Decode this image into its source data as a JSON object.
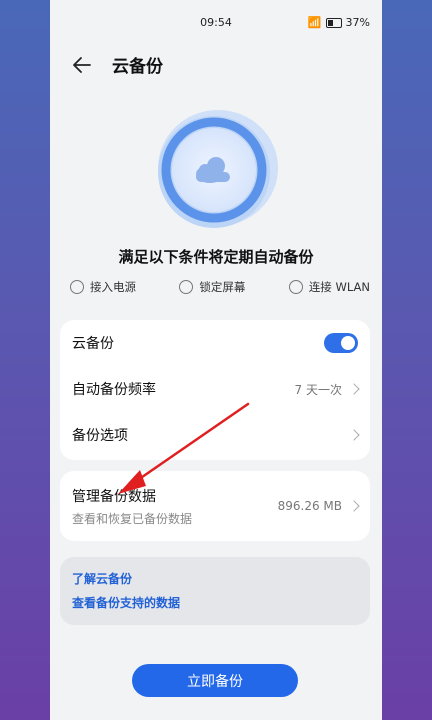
{
  "status_bar": {
    "time": "09:54",
    "battery": "37%"
  },
  "header": {
    "title": "云备份"
  },
  "hero": {
    "heading": "满足以下条件将定期自动备份"
  },
  "conditions": [
    {
      "label": "接入电源",
      "icon": "power-plug-icon"
    },
    {
      "label": "锁定屏幕",
      "icon": "lock-icon"
    },
    {
      "label": "连接 WLAN",
      "icon": "wifi-icon"
    }
  ],
  "settings": {
    "cloud_backup_label": "云备份",
    "cloud_backup_enabled": true,
    "frequency_label": "自动备份频率",
    "frequency_value": "7 天一次",
    "options_label": "备份选项"
  },
  "manage": {
    "label": "管理备份数据",
    "subtitle": "查看和恢复已备份数据",
    "size": "896.26 MB"
  },
  "links": {
    "learn": "了解云备份",
    "supported": "查看备份支持的数据"
  },
  "action": {
    "backup_now": "立即备份"
  },
  "colors": {
    "accent": "#2468ea",
    "annotation_arrow": "#e02020"
  }
}
